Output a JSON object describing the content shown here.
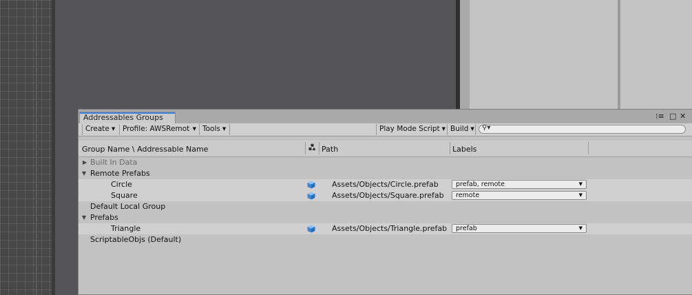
{
  "window": {
    "tab_title": "Addressables Groups",
    "controls": [
      "⁝≡",
      "□",
      "✕"
    ]
  },
  "toolbar": {
    "create": "Create",
    "profile": "Profile: AWSRemote",
    "tools": "Tools",
    "play_mode": "Play Mode Script",
    "build": "Build",
    "search_placeholder": ""
  },
  "columns": {
    "name": "Group Name \\ Addressable Name",
    "icon": "asset-type-icon",
    "path": "Path",
    "labels": "Labels"
  },
  "groups": [
    {
      "name": "Built In Data",
      "expanded": false,
      "disabled": true
    },
    {
      "name": "Remote Prefabs",
      "expanded": true
    },
    {
      "name": "Circle",
      "path": "Assets/Objects/Circle.prefab",
      "labels": "prefab, remote"
    },
    {
      "name": "Square",
      "path": "Assets/Objects/Square.prefab",
      "labels": "remote"
    },
    {
      "name": "Default Local Group"
    },
    {
      "name": "Prefabs",
      "expanded": true
    },
    {
      "name": "Triangle",
      "path": "Assets/Objects/Triangle.prefab",
      "labels": "prefab"
    },
    {
      "name": "ScriptableObjs (Default)"
    }
  ],
  "icons": {
    "prefab": "prefab-cube-icon",
    "expand_collapsed": "triangle-right-icon",
    "expand_open": "triangle-down-icon",
    "search": "search-icon",
    "dropdown": "dropdown-arrow-icon"
  },
  "colors": {
    "accent_tab": "#3d7fd8",
    "prefab_icon": "#4a90e2",
    "panel_bg": "#c2c2c2"
  }
}
